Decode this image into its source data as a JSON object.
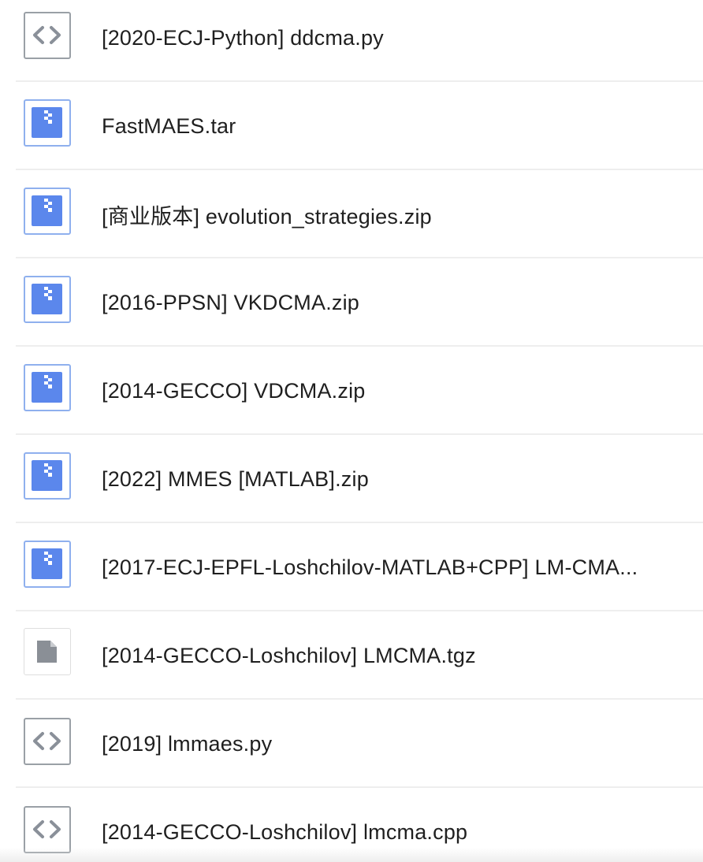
{
  "files": [
    {
      "name": "[2020-ECJ-Python] ddcma.py",
      "icon": "code-file-icon"
    },
    {
      "name": "FastMAES.tar",
      "icon": "archive-file-icon"
    },
    {
      "name": "[商业版本] evolution_strategies.zip",
      "icon": "archive-file-icon"
    },
    {
      "name": "[2016-PPSN] VKDCMA.zip",
      "icon": "archive-file-icon"
    },
    {
      "name": "[2014-GECCO] VDCMA.zip",
      "icon": "archive-file-icon"
    },
    {
      "name": "[2022] MMES [MATLAB].zip",
      "icon": "archive-file-icon"
    },
    {
      "name": "[2017-ECJ-EPFL-Loshchilov-MATLAB+CPP] LM-CMA...",
      "icon": "archive-file-icon"
    },
    {
      "name": "[2014-GECCO-Loshchilov] LMCMA.tgz",
      "icon": "generic-file-icon"
    },
    {
      "name": "[2019] lmmaes.py",
      "icon": "code-file-icon"
    },
    {
      "name": "[2014-GECCO-Loshchilov] lmcma.cpp",
      "icon": "code-file-icon"
    }
  ],
  "colors": {
    "archive_icon": "#5b87ec",
    "archive_border": "#8fb0ee",
    "code_icon": "#8a9099",
    "generic_icon": "#8a8f96",
    "divider": "#eeeeee",
    "text": "#1f1f1f"
  }
}
